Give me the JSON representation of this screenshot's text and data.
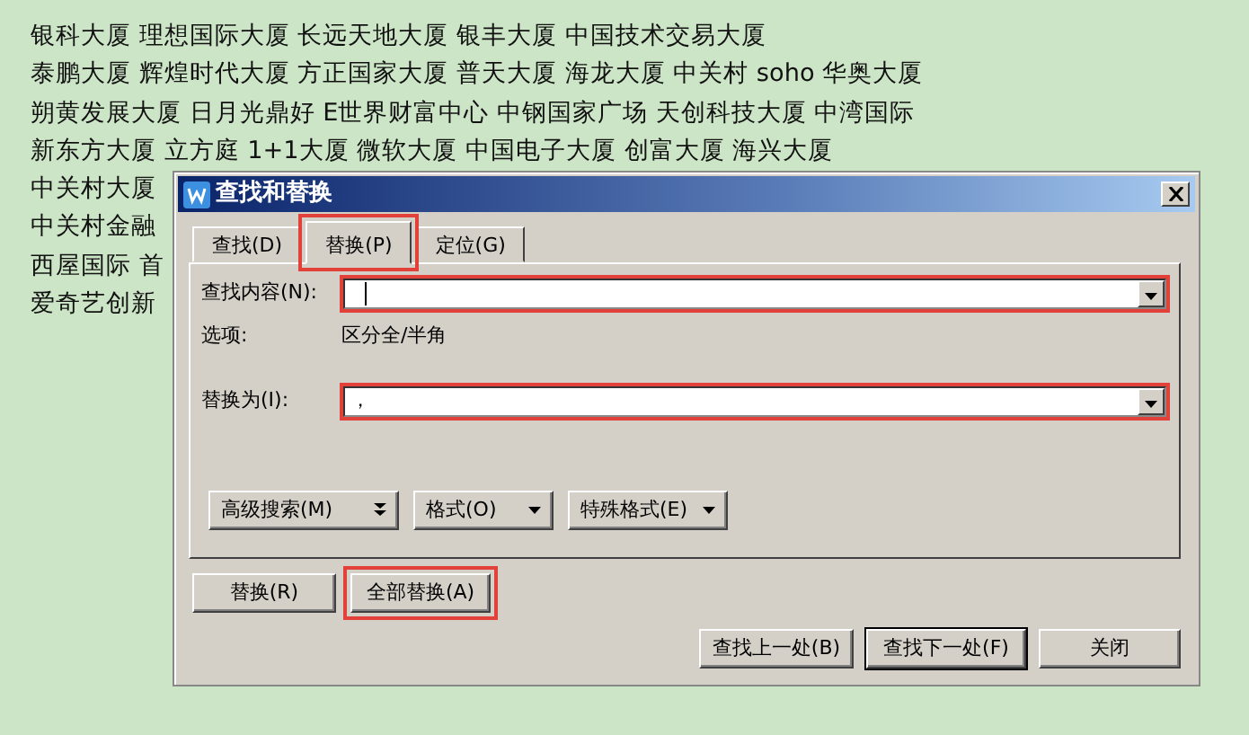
{
  "document": {
    "lines": [
      "银科大厦 理想国际大厦 长远天地大厦 银丰大厦 中国技术交易大厦",
      "泰鹏大厦 辉煌时代大厦 方正国家大厦 普天大厦 海龙大厦 中关村 soho 华奥大厦",
      "朔黄发展大厦 日月光鼎好 E世界财富中心 中钢国家广场 天创科技大厦 中湾国际",
      "新东方大厦 立方庭 1+1大厦 微软大厦 中国电子大厦 创富大厦 海兴大厦",
      "中关村大厦",
      "中关村金融",
      "西屋国际 首",
      "爱奇艺创新"
    ]
  },
  "dialog": {
    "title": "查找和替换",
    "tabs": [
      {
        "label": "查找(D)",
        "selected": false,
        "highlighted": false
      },
      {
        "label": "替换(P)",
        "selected": true,
        "highlighted": true
      },
      {
        "label": "定位(G)",
        "selected": false,
        "highlighted": false
      }
    ],
    "find": {
      "label": "查找内容(N):",
      "caret": true,
      "highlighted": true
    },
    "options": {
      "label": "选项:",
      "value": "区分全/半角"
    },
    "replace": {
      "label": "替换为(I):",
      "value": "，",
      "highlighted": true
    },
    "search_buttons": [
      {
        "label": "高级搜索(M)",
        "kind": "expand"
      },
      {
        "label": "格式(O)",
        "kind": "dropdown"
      },
      {
        "label": "特殊格式(E)",
        "kind": "dropdown"
      }
    ],
    "action_buttons": [
      {
        "label": "替换(R)",
        "highlighted": false
      },
      {
        "label": "全部替换(A)",
        "highlighted": true
      }
    ],
    "nav_buttons": [
      {
        "label": "查找上一处(B)",
        "default": false
      },
      {
        "label": "查找下一处(F)",
        "default": true
      },
      {
        "label": "关闭",
        "default": false
      }
    ]
  }
}
